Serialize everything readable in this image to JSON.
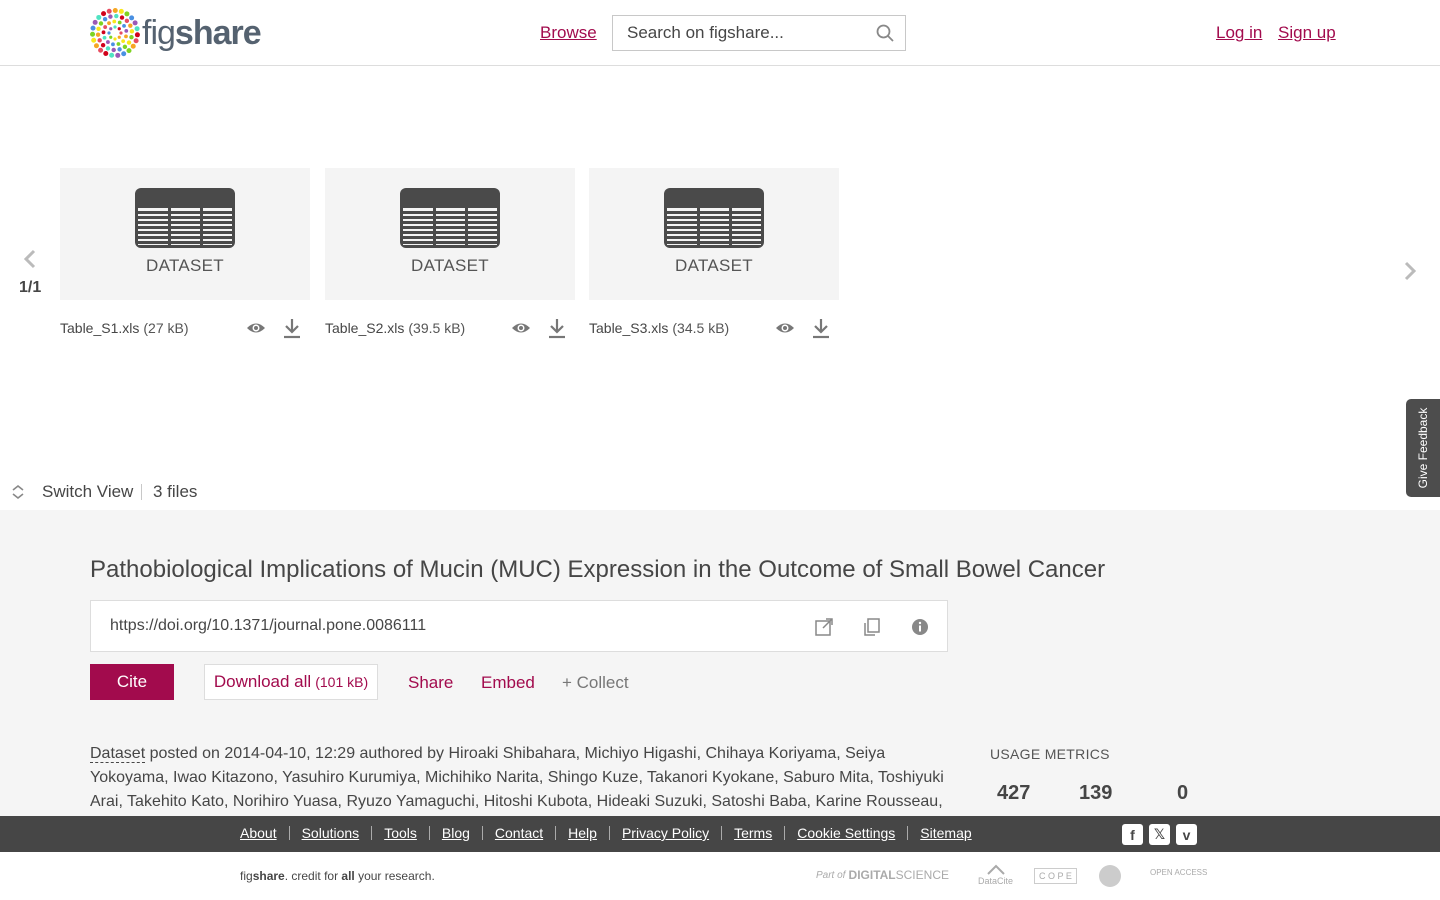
{
  "header": {
    "logo_text_light": "fig",
    "logo_text_bold": "share",
    "browse": "Browse",
    "search_placeholder": "Search on figshare...",
    "login": "Log in",
    "signup": "Sign up"
  },
  "carousel": {
    "page": "1/1",
    "files": [
      {
        "type_label": "DATASET",
        "name": "Table_S1.xls",
        "size": "(27 kB)"
      },
      {
        "type_label": "DATASET",
        "name": "Table_S2.xls",
        "size": "(39.5 kB)"
      },
      {
        "type_label": "DATASET",
        "name": "Table_S3.xls",
        "size": "(34.5 kB)"
      }
    ]
  },
  "feedback": "Give Feedback",
  "view_bar": {
    "switch_view": "Switch View",
    "files_count": "3 files"
  },
  "item": {
    "title": "Pathobiological Implications of Mucin (MUC) Expression in the Outcome of Small Bowel Cancer",
    "doi": "https://doi.org/10.1371/journal.pone.0086111",
    "cite": "Cite",
    "download_all": "Download all",
    "download_all_size": "(101 kB)",
    "share": "Share",
    "embed": "Embed",
    "collect": "+ Collect",
    "item_type": "Dataset",
    "posted_text": " posted on 2014-04-10, 12:29 authored by Hiroaki Shibahara, Michiyo Higashi, Chihaya Koriyama, Seiya Yokoyama, Iwao Kitazono, Yasuhiro Kurumiya, Michihiko Narita, Shingo Kuze, Takanori Kyokane, Saburo Mita, Toshiyuki Arai, Takehito Kato, Norihiro Yuasa, Ryuzo Yamaguchi, Hitoshi Kubota, Hideaki Suzuki, Satoshi Baba, Karine Rousseau,"
  },
  "usage": {
    "title": "USAGE METRICS",
    "values": [
      "427",
      "139",
      "0"
    ]
  },
  "footer": {
    "links": [
      "About",
      "Solutions",
      "Tools",
      "Blog",
      "Contact",
      "Help",
      "Privacy Policy",
      "Terms",
      "Cookie Settings",
      "Sitemap"
    ],
    "tagline_pre": "fig",
    "tagline_bold": "share",
    "tagline_mid": ". credit for ",
    "tagline_all": "all",
    "tagline_post": " your research.",
    "partners": {
      "digital_science_pre": "Part of",
      "digital_science_bold": "DIGITAL",
      "digital_science_post": "SCIENCE",
      "datacite": "DataCite",
      "cope": "C O P E",
      "open_access": "OPEN ACCESS"
    }
  },
  "colors": {
    "brand": "#a20b4d",
    "text": "#464646",
    "footer_bg": "#464646",
    "details_bg": "#f5f5f5"
  }
}
